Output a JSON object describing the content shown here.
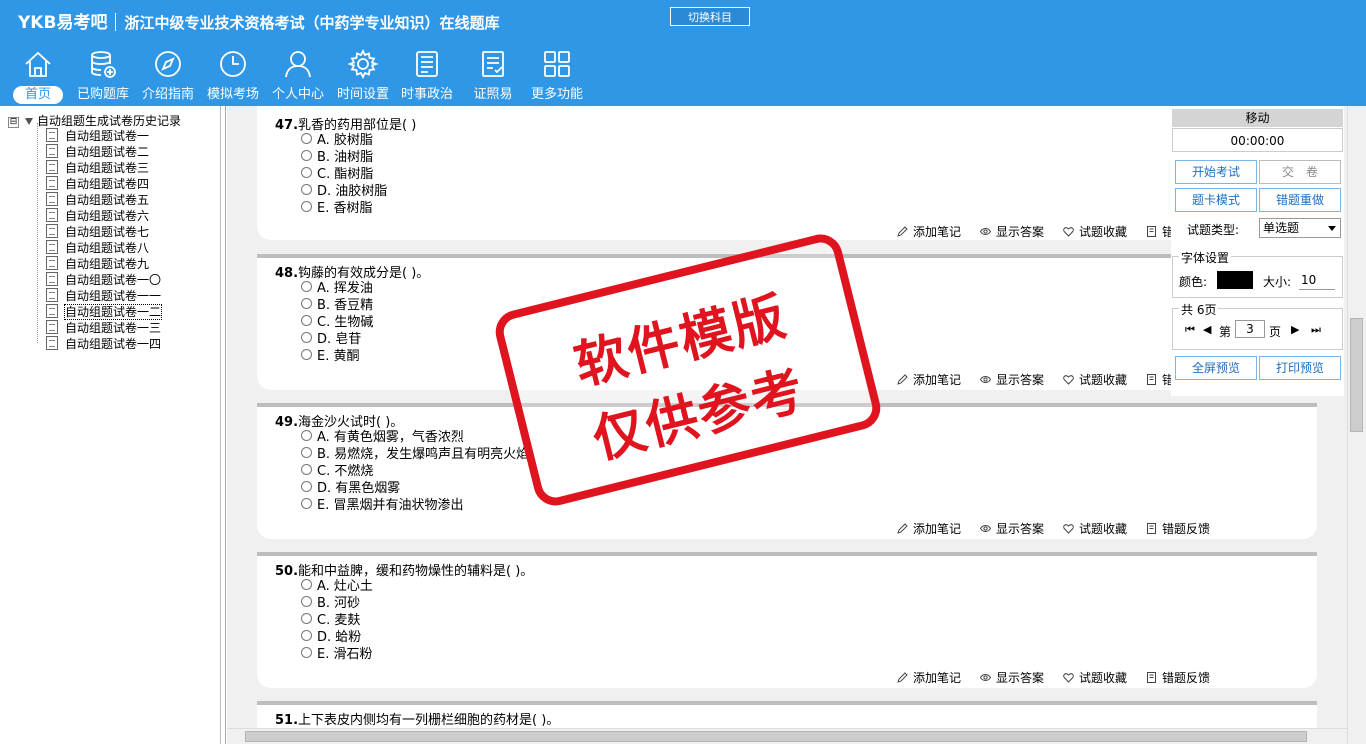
{
  "header": {
    "logo": "YKB易考吧",
    "title": "浙江中级专业技术资格考试（中药学专业知识）在线题库",
    "switch_subject": "切换科目",
    "nav": [
      {
        "label": "首页",
        "icon": "home-icon",
        "active": true
      },
      {
        "label": "已购题库",
        "icon": "database-icon"
      },
      {
        "label": "介绍指南",
        "icon": "compass-icon"
      },
      {
        "label": "模拟考场",
        "icon": "clock-icon"
      },
      {
        "label": "个人中心",
        "icon": "user-icon"
      },
      {
        "label": "时间设置",
        "icon": "gear-icon"
      },
      {
        "label": "时事政治",
        "icon": "newspaper-icon"
      },
      {
        "label": "证照易",
        "icon": "checklist-icon"
      },
      {
        "label": "更多功能",
        "icon": "grid-icon"
      }
    ]
  },
  "tree": {
    "root": "自动组题生成试卷历史记录",
    "toggle": "⊟",
    "items": [
      "自动组题试卷一",
      "自动组题试卷二",
      "自动组题试卷三",
      "自动组题试卷四",
      "自动组题试卷五",
      "自动组题试卷六",
      "自动组题试卷七",
      "自动组题试卷八",
      "自动组题试卷九",
      "自动组题试卷一〇",
      "自动组题试卷一一",
      "自动组题试卷一二",
      "自动组题试卷一三",
      "自动组题试卷一四"
    ],
    "selected_index": 11
  },
  "questions": [
    {
      "num": "47.",
      "text": "乳香的药用部位是( )",
      "options": [
        "A. 胶树脂",
        "B. 油树脂",
        "C. 酯树脂",
        "D. 油胶树脂",
        "E. 香树脂"
      ]
    },
    {
      "num": "48.",
      "text": "钩藤的有效成分是( )。",
      "options": [
        "A. 挥发油",
        "B. 香豆精",
        "C. 生物碱",
        "D. 皂苷",
        "E. 黄酮"
      ]
    },
    {
      "num": "49.",
      "text": "海金沙火试时( )。",
      "options": [
        "A. 有黄色烟雾，气香浓烈",
        "B. 易燃烧，发生爆鸣声且有明亮火焰",
        "C. 不燃烧",
        "D. 有黑色烟雾",
        "E. 冒黑烟并有油状物渗出"
      ]
    },
    {
      "num": "50.",
      "text": "能和中益脾，缓和药物燥性的辅料是( )。",
      "options": [
        "A. 灶心土",
        "B. 河砂",
        "C. 麦麸",
        "D. 蛤粉",
        "E. 滑石粉"
      ]
    },
    {
      "num": "51.",
      "text": "上下表皮内侧均有一列栅栏细胞的药材是( )。",
      "options": []
    }
  ],
  "actions": {
    "note": "添加笔记",
    "answer": "显示答案",
    "favorite": "试题收藏",
    "feedback": "错题反馈",
    "feedback_truncated": "错"
  },
  "panel": {
    "move": "移动",
    "timer": "00:00:00",
    "start": "开始考试",
    "submit": "交　卷",
    "card_mode": "题卡模式",
    "redo_wrong": "错题重做",
    "qtype_label": "试题类型:",
    "qtype_value": "单选题",
    "font_group": "字体设置",
    "color_label": "颜色:",
    "color_value": "#000000",
    "size_label": "大小:",
    "size_value": "10",
    "pages_group": "共 6页",
    "page_prefix": "第",
    "page_value": "3",
    "page_suffix": "页",
    "first": "⏮",
    "prev": "◀",
    "next": "▶",
    "last": "⏭",
    "fullscreen": "全屏预览",
    "print": "打印预览"
  },
  "watermark": {
    "line1": "软件模版",
    "line2": "仅供参考"
  },
  "colors": {
    "header_bg": "#2f97e6",
    "stamp": "#e0141e"
  }
}
